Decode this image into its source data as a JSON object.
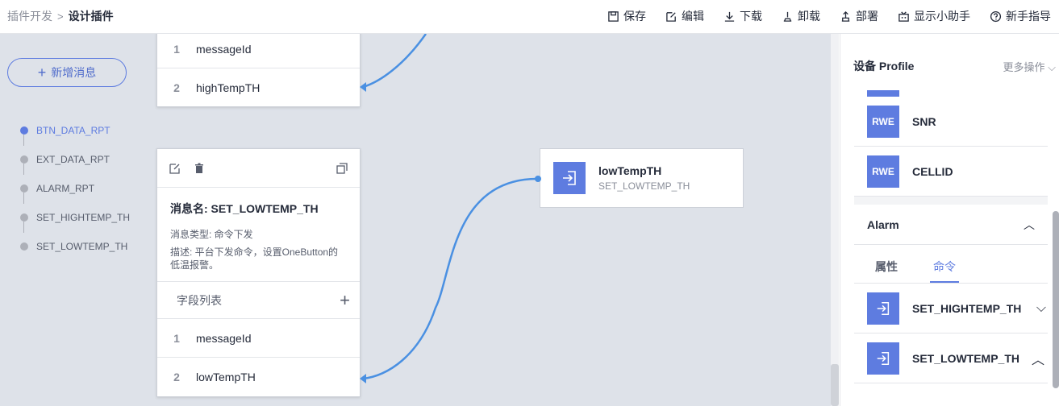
{
  "breadcrumb": {
    "parent": "插件开发",
    "separator": ">",
    "current": "设计插件"
  },
  "toolbar": [
    {
      "label": "保存",
      "icon": "save-icon"
    },
    {
      "label": "编辑",
      "icon": "edit-icon"
    },
    {
      "label": "下载",
      "icon": "download-icon"
    },
    {
      "label": "卸载",
      "icon": "uninstall-icon"
    },
    {
      "label": "部署",
      "icon": "deploy-icon"
    },
    {
      "label": "显示小助手",
      "icon": "assistant-icon"
    },
    {
      "label": "新手指导",
      "icon": "help-icon"
    }
  ],
  "add_message": "新增消息",
  "messages": [
    "BTN_DATA_RPT",
    "EXT_DATA_RPT",
    "ALARM_RPT",
    "SET_HIGHTEMP_TH",
    "SET_LOWTEMP_TH"
  ],
  "top_card": {
    "fields": [
      {
        "idx": "1",
        "name": "messageId"
      },
      {
        "idx": "2",
        "name": "highTempTH"
      }
    ]
  },
  "msg_card": {
    "title": "消息名: SET_LOWTEMP_TH",
    "type": "消息类型: 命令下发",
    "desc": "描述: 平台下发命令，设置OneButton的低温报警。",
    "field_list": "字段列表",
    "fields": [
      {
        "idx": "1",
        "name": "messageId"
      },
      {
        "idx": "2",
        "name": "lowTempTH"
      }
    ]
  },
  "property_node": {
    "name": "lowTempTH",
    "command": "SET_LOWTEMP_TH"
  },
  "panel": {
    "title": "设备 Profile",
    "more": "更多操作",
    "properties": [
      {
        "badge": "RWE",
        "name": "SNR"
      },
      {
        "badge": "RWE",
        "name": "CELLID"
      }
    ],
    "alarm_title": "Alarm",
    "tabs": [
      "属性",
      "命令"
    ],
    "commands": [
      "SET_HIGHTEMP_TH",
      "SET_LOWTEMP_TH"
    ]
  },
  "colors": {
    "accent": "#5e7ce0",
    "canvas": "#dee2e9",
    "connector": "#4a90e2"
  }
}
